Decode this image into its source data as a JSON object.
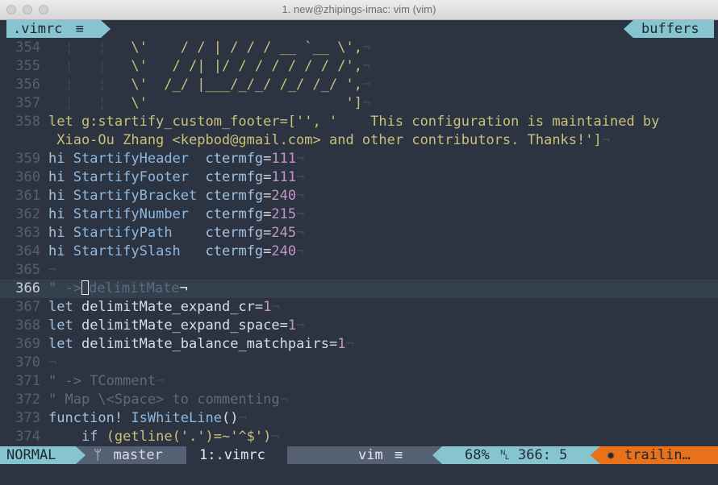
{
  "window": {
    "title": "1. new@zhipings-imac: vim (vim)"
  },
  "tabline": {
    "file_tab": ".vimrc",
    "buffers_label": "buffers"
  },
  "editor": {
    "lines": [
      {
        "n": "354",
        "indent": "  ¦   ¦   ",
        "art": "\\'    / / | / / / __ `__ \\',",
        "eol": "¬"
      },
      {
        "n": "355",
        "indent": "  ¦   ¦   ",
        "art": "\\'   / /| |/ / / / / / / /',",
        "eol": "¬"
      },
      {
        "n": "356",
        "indent": "  ¦   ¦   ",
        "art": "\\'  /_/ |___/_/_/ /_/ /_/ ',",
        "eol": "¬"
      },
      {
        "n": "357",
        "indent": "  ¦   ¦   ",
        "art": "\\'                        ']",
        "eol": "¬"
      },
      {
        "n": "358",
        "text1": "let g:startify_custom_footer=['', '    This configuration is maintained by",
        "text2": " Xiao-Ou Zhang <kepbod@gmail.com> and other contributors. Thanks!']",
        "eol": "¬"
      },
      {
        "n": "359",
        "hi": "StartifyHeader ",
        "ctermfg": "111"
      },
      {
        "n": "360",
        "hi": "StartifyFooter ",
        "ctermfg": "111"
      },
      {
        "n": "361",
        "hi": "StartifyBracket",
        "ctermfg": "240"
      },
      {
        "n": "362",
        "hi": "StartifyNumber ",
        "ctermfg": "215"
      },
      {
        "n": "363",
        "hi": "StartifyPath   ",
        "ctermfg": "245"
      },
      {
        "n": "364",
        "hi": "StartifySlash  ",
        "ctermfg": "240"
      },
      {
        "n": "365",
        "blank": "¬"
      },
      {
        "n": "366",
        "c1": "\" ->",
        "c2": "delimitMate",
        "eol": "¬"
      },
      {
        "n": "367",
        "let": "delimitMate_expand_cr",
        "val": "1"
      },
      {
        "n": "368",
        "let": "delimitMate_expand_space",
        "val": "1"
      },
      {
        "n": "369",
        "let": "delimitMate_balance_matchpairs",
        "val": "1"
      },
      {
        "n": "370",
        "blank": "¬"
      },
      {
        "n": "371",
        "comment": "\" -> TComment"
      },
      {
        "n": "372",
        "comment": "\" Map \\<Space> to commenting"
      },
      {
        "n": "373",
        "func_kw": "function!",
        "func_name": "IsWhiteLine",
        "func_rest": "()"
      },
      {
        "n": "374",
        "if_kw": "if",
        "if_rest": "(getline('.')=~'^$')"
      }
    ],
    "eol": "¬",
    "let_kw": "let",
    "hi_kw": "hi",
    "ctermfg_kw": "ctermfg",
    "eq": "="
  },
  "statusline": {
    "mode": "NORMAL",
    "branch": "master",
    "file": "1:.vimrc",
    "filetype": "vim",
    "percent": "68%",
    "line_col": "366:  5",
    "warning": "trailin…"
  }
}
